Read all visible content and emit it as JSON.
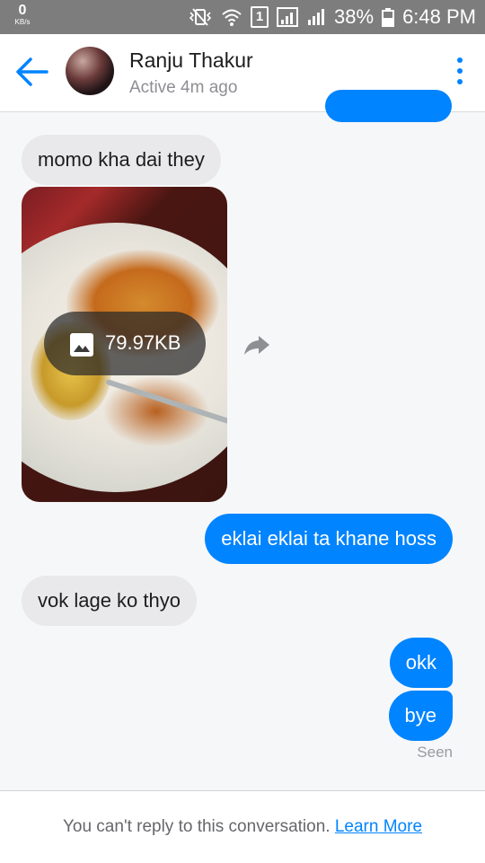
{
  "status_bar": {
    "speed_value": "0",
    "speed_unit": "KB/s",
    "sim_slot": "1",
    "battery": "38%",
    "time": "6:48 PM"
  },
  "header": {
    "name": "Ranju Thakur",
    "status": "Active 4m ago"
  },
  "messages": [
    {
      "sender": "them",
      "text": "momo kha dai they"
    },
    {
      "sender": "them",
      "type": "photo",
      "size": "79.97KB"
    },
    {
      "sender": "me",
      "text": "eklai eklai ta khane hoss"
    },
    {
      "sender": "them",
      "text": "vok lage ko thyo"
    },
    {
      "sender": "me",
      "text": "okk"
    },
    {
      "sender": "me",
      "text": "bye"
    }
  ],
  "seen_label": "Seen",
  "footer": {
    "notice": "You can't reply to this conversation.",
    "link": "Learn More"
  },
  "colors": {
    "accent": "#0084ff",
    "incoming_bubble": "#e9e9eb",
    "status_bar": "#7d7d7d"
  }
}
